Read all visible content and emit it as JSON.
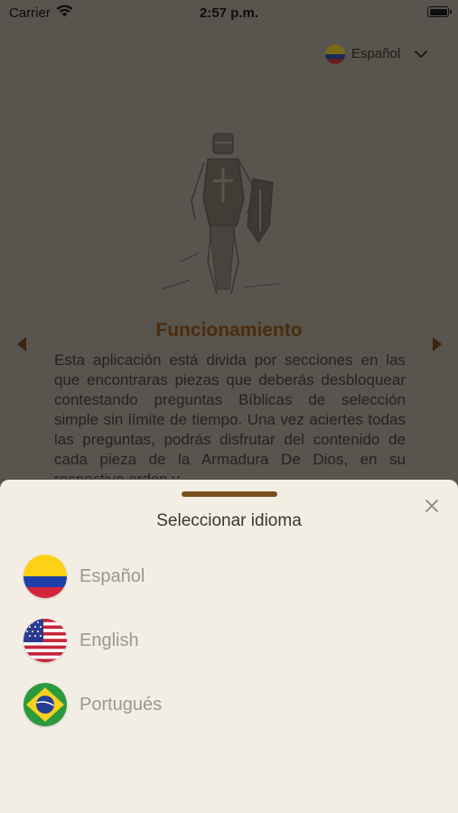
{
  "status_bar": {
    "carrier": "Carrier",
    "time": "2:57 p.m."
  },
  "header": {
    "language_selector": {
      "label": "Español",
      "flag_icon": "colombia-flag-icon",
      "chevron_icon": "chevron-down-icon"
    }
  },
  "main": {
    "illustration": "knight-armor-illustration",
    "title": "Funcionamiento",
    "body": "Esta aplicación está divida por secciones en las que encontraras piezas que deberás desbloquear contestando preguntas Bíblicas de selección simple sin límite de tiempo. Una vez aciertes todas las preguntas, podrás disfrutar del contenido de cada pieza de la Armadura De Dios, en su respectivo orden y",
    "prev_icon": "arrow-left-icon",
    "next_icon": "arrow-right-icon"
  },
  "language_sheet": {
    "title": "Seleccionar idioma",
    "close_icon": "close-icon",
    "options": [
      {
        "label": "Español",
        "flag": "colombia-flag-icon"
      },
      {
        "label": "English",
        "flag": "usa-flag-icon"
      },
      {
        "label": "Portugués",
        "flag": "brazil-flag-icon"
      }
    ]
  },
  "colors": {
    "overlay_background": "#58544e",
    "sheet_background": "#f3eee4",
    "accent_brown": "#7a4f1e",
    "title_brown": "#4c2c0c"
  }
}
